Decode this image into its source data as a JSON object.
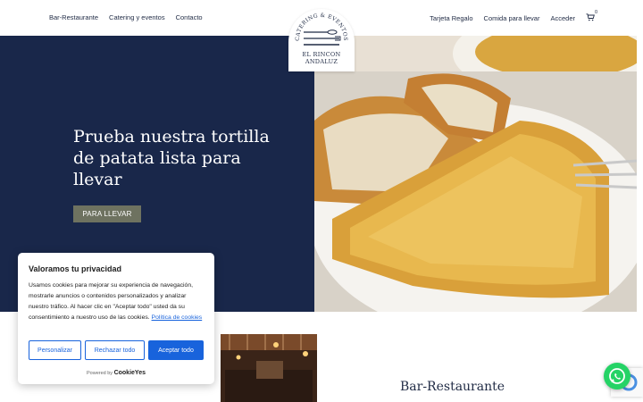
{
  "header": {
    "nav_left": [
      "Bar-Restaurante",
      "Catering y eventos",
      "Contacto"
    ],
    "nav_right": [
      "Tarjeta Regalo",
      "Comida para llevar",
      "Acceder"
    ],
    "cart_count": "0",
    "logo": {
      "arc_text": "CATERING & EVENTOS",
      "line1": "EL RINCON",
      "line2": "ANDALUZ"
    }
  },
  "hero": {
    "title": "Prueba nuestra tortilla de patata lista para llevar",
    "button": "PARA LLEVAR",
    "bg_color": "#19274a"
  },
  "section": {
    "title": "Bar-Restaurante"
  },
  "cookie": {
    "title": "Valoramos tu privacidad",
    "text": "Usamos cookies para mejorar su experiencia de navegación, mostrarle anuncios o contenidos personalizados y analizar nuestro tráfico. Al hacer clic en \"Aceptar todo\" usted da su consentimiento a nuestro uso de las cookies.",
    "link": "Política de cookies",
    "btn_customize": "Personalizar",
    "btn_reject": "Rechazar todo",
    "btn_accept": "Aceptar todo",
    "powered_by": "Powered by",
    "brand": "CookieYes",
    "accent": "#1863dc"
  },
  "icons": {
    "whatsapp": "whatsapp-icon",
    "cart": "cart-icon",
    "recaptcha": "recaptcha-icon"
  }
}
